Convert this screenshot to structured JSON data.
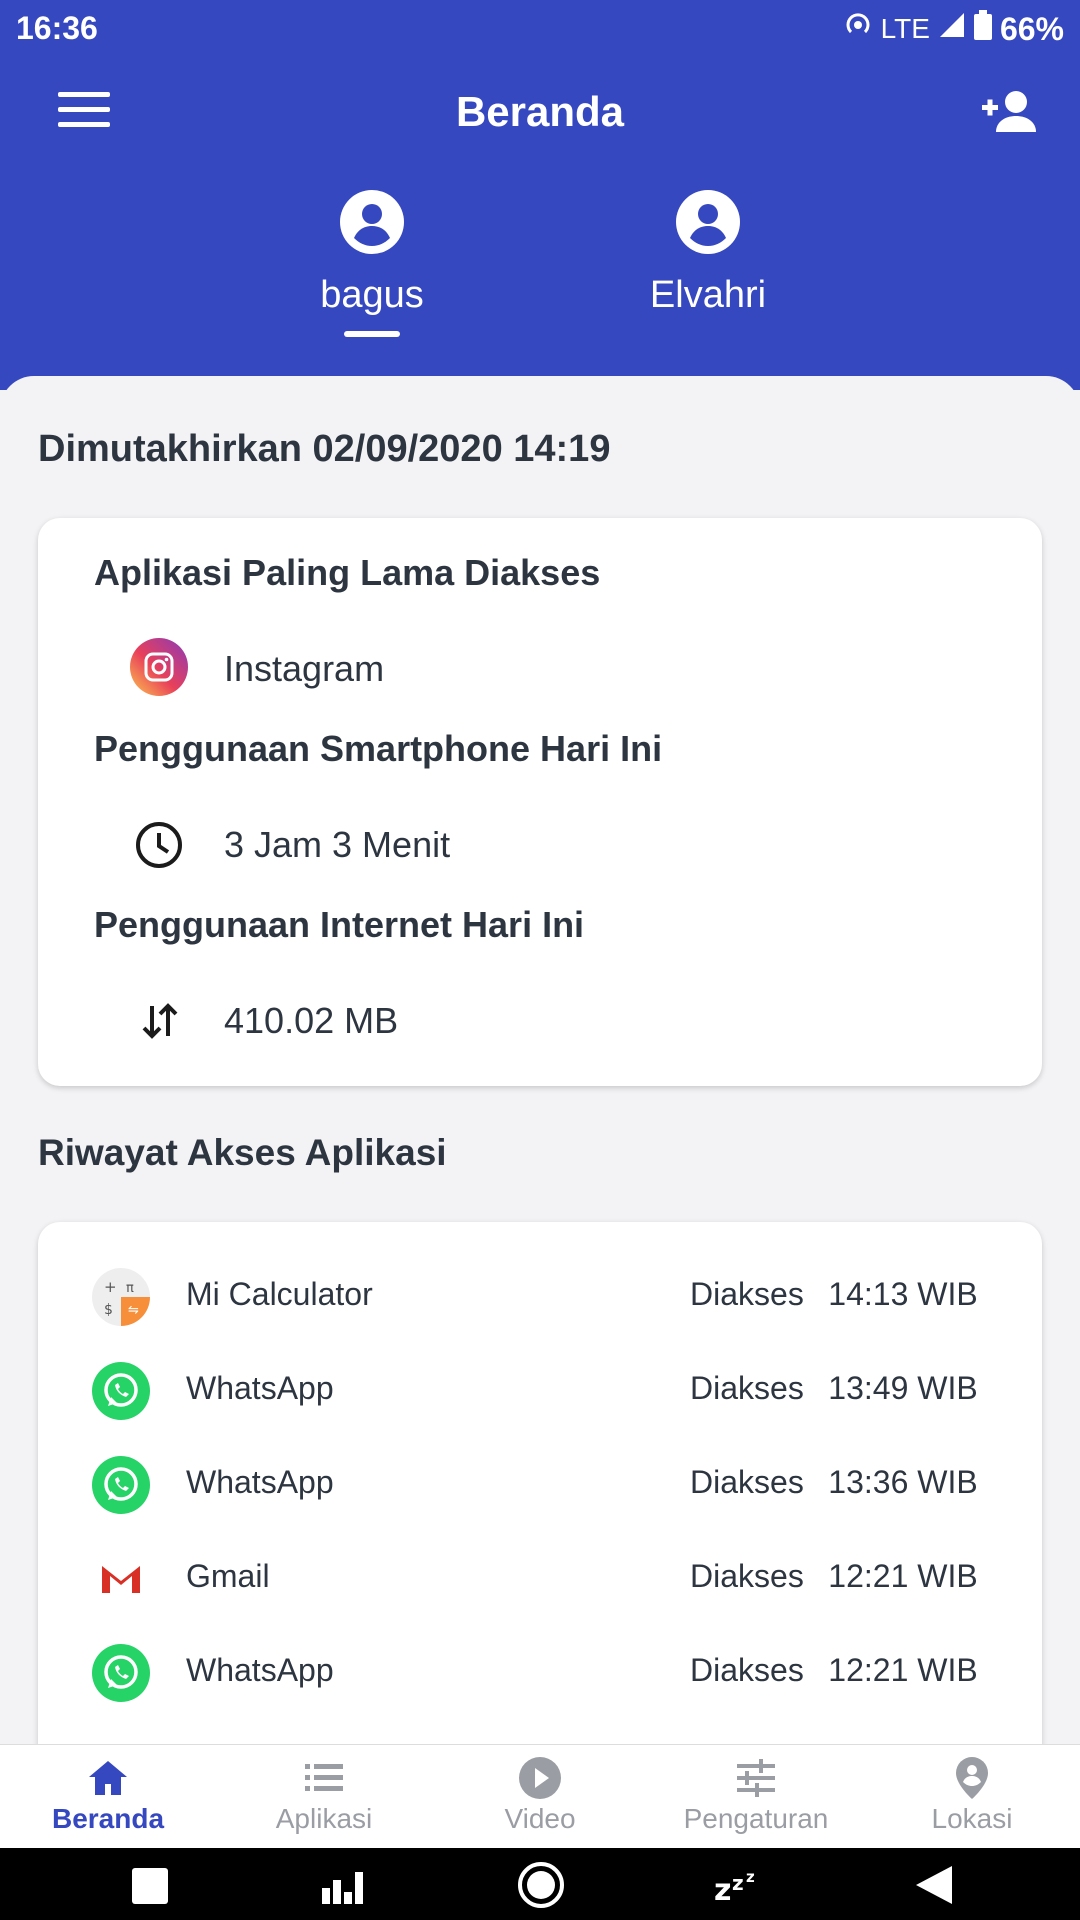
{
  "status_bar": {
    "time": "16:36",
    "network": "LTE",
    "battery": "66%"
  },
  "header": {
    "title": "Beranda",
    "menu_icon": "hamburger-menu-icon",
    "add_user_icon": "person-add-icon",
    "profiles": [
      {
        "name": "bagus",
        "selected": true
      },
      {
        "name": "Elvahri",
        "selected": false
      }
    ]
  },
  "main": {
    "updated": "Dimutakhirkan 02/09/2020 14:19",
    "summary": {
      "most_used_title": "Aplikasi Paling Lama Diakses",
      "most_used_app": "Instagram",
      "usage_title": "Penggunaan Smartphone Hari Ini",
      "usage_value": "3 Jam 3 Menit",
      "internet_title": "Penggunaan Internet Hari Ini",
      "internet_value": "410.02 MB"
    },
    "history_title": "Riwayat Akses Aplikasi",
    "history": [
      {
        "app": "Mi Calculator",
        "label": "Diakses",
        "time": "14:13 WIB",
        "icon": "calculator-icon"
      },
      {
        "app": "WhatsApp",
        "label": "Diakses",
        "time": "13:49 WIB",
        "icon": "whatsapp-icon"
      },
      {
        "app": "WhatsApp",
        "label": "Diakses",
        "time": "13:36 WIB",
        "icon": "whatsapp-icon"
      },
      {
        "app": "Gmail",
        "label": "Diakses",
        "time": "12:21 WIB",
        "icon": "gmail-icon"
      },
      {
        "app": "WhatsApp",
        "label": "Diakses",
        "time": "12:21 WIB",
        "icon": "whatsapp-icon"
      }
    ]
  },
  "bottom_nav": [
    {
      "label": "Beranda",
      "active": true,
      "icon": "home-icon"
    },
    {
      "label": "Aplikasi",
      "active": false,
      "icon": "list-icon"
    },
    {
      "label": "Video",
      "active": false,
      "icon": "play-icon"
    },
    {
      "label": "Pengaturan",
      "active": false,
      "icon": "sliders-icon"
    },
    {
      "label": "Lokasi",
      "active": false,
      "icon": "location-icon"
    }
  ],
  "colors": {
    "primary": "#3648c0",
    "text": "#2d3540",
    "inactive": "#9a9da3"
  }
}
